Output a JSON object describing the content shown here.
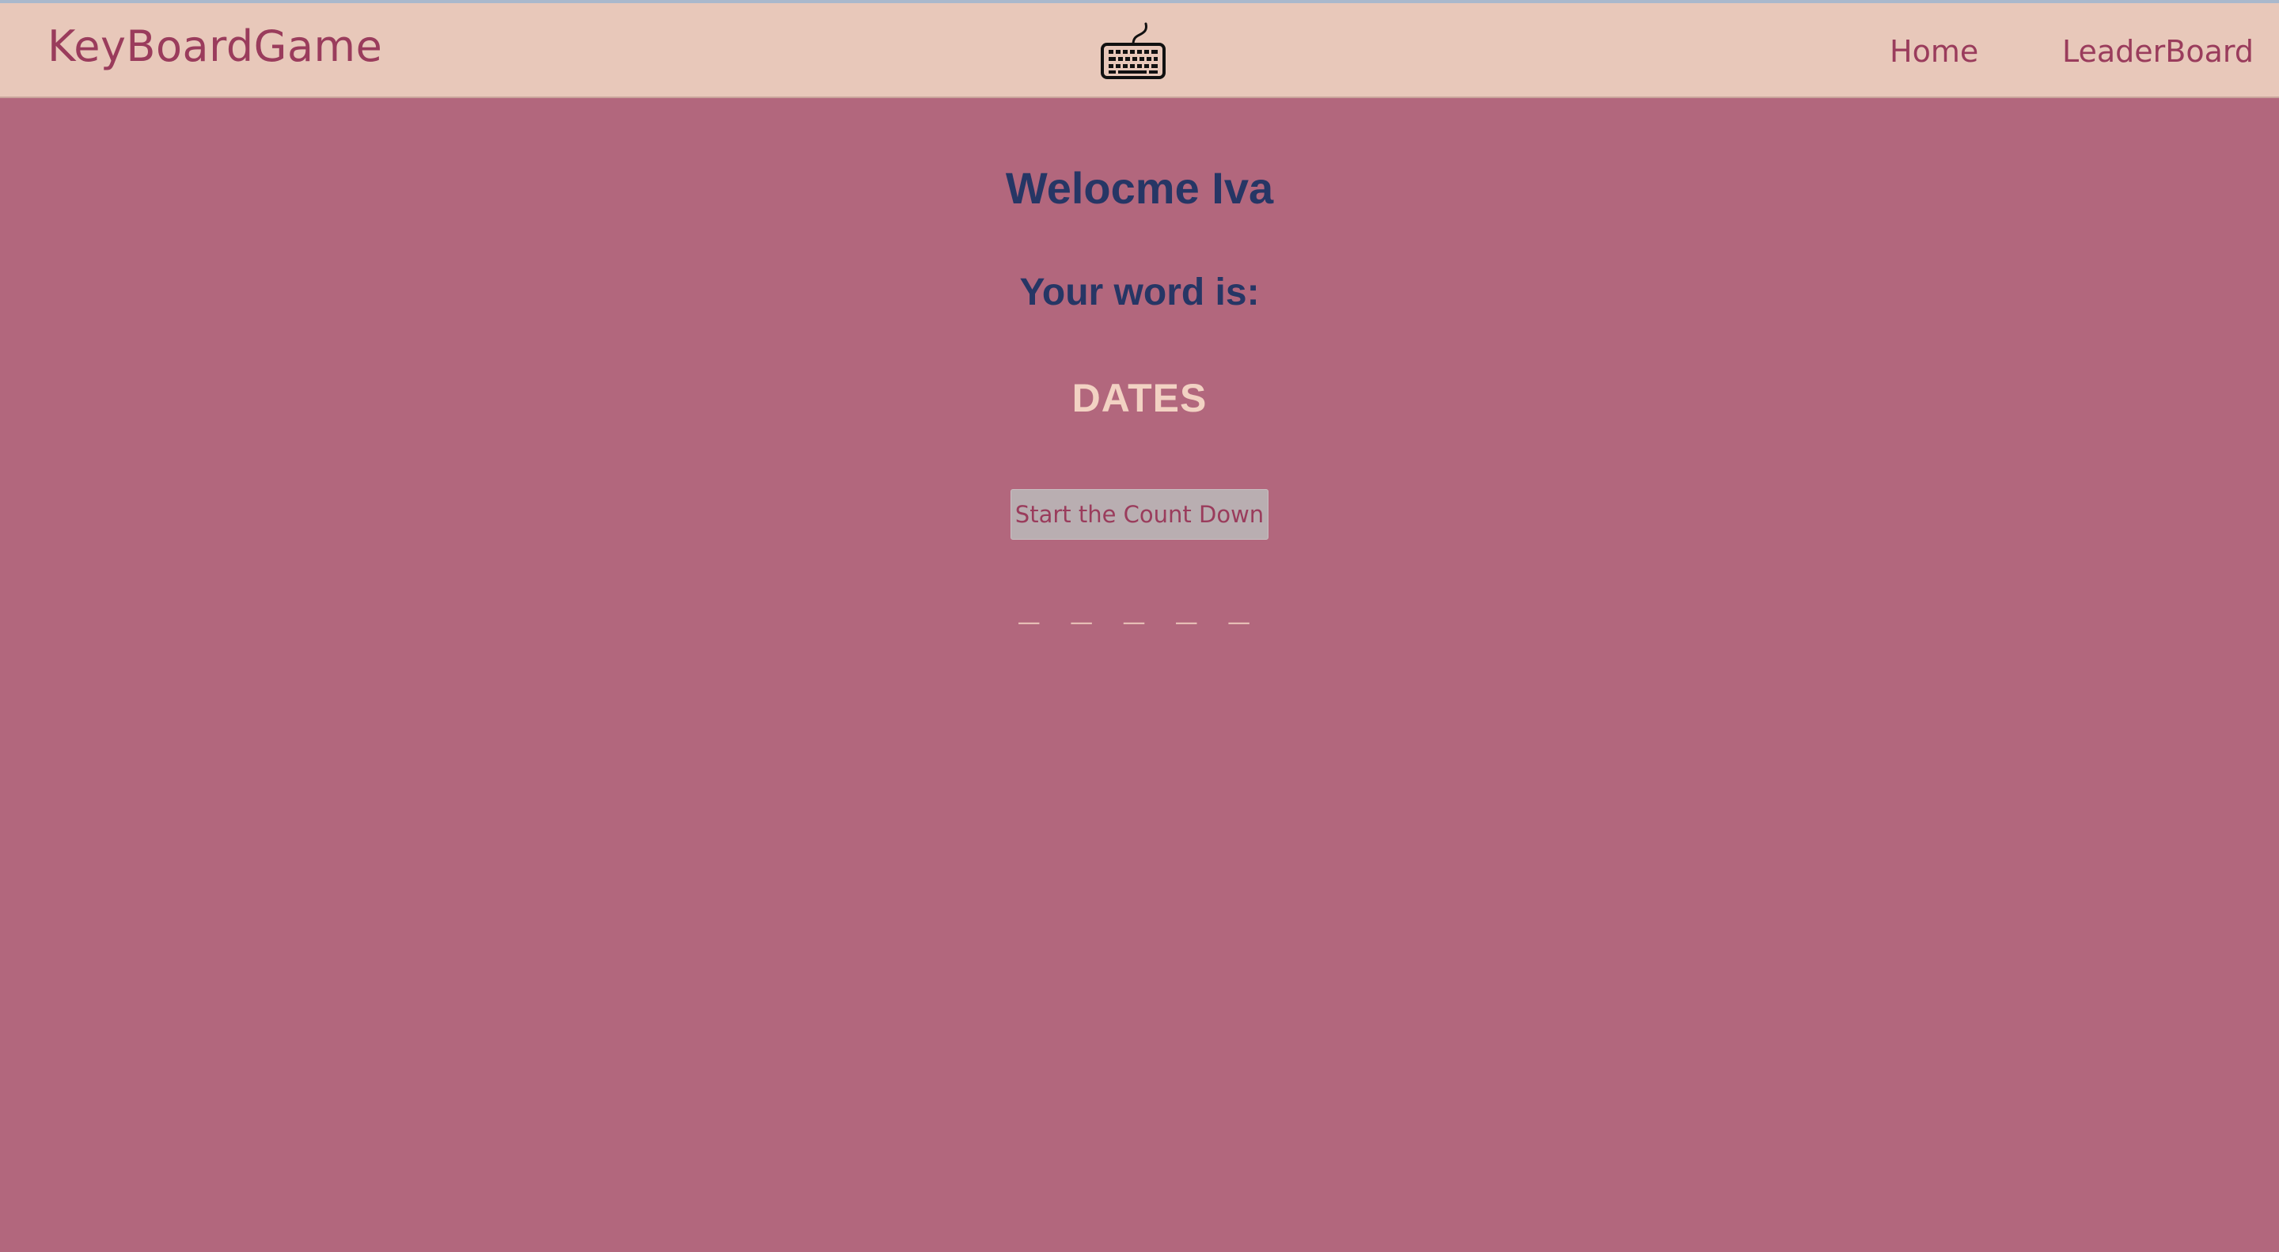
{
  "navbar": {
    "brand": "KeyBoardGame",
    "logo_icon": "keyboard-icon",
    "links": [
      {
        "label": "Home"
      },
      {
        "label": "LeaderBoard"
      }
    ]
  },
  "main": {
    "welcome": "Welocme Iva",
    "word_label": "Your word is:",
    "word": "DATES",
    "start_button_label": "Start the Count Down",
    "blanks": "_ _ _ _ _"
  },
  "colors": {
    "background": "#b2677d",
    "navbar": "#e8c8ba",
    "accent": "#9a3c5c",
    "heading": "#263665",
    "word": "#f2d2c3",
    "button": "#b9aeb1"
  }
}
